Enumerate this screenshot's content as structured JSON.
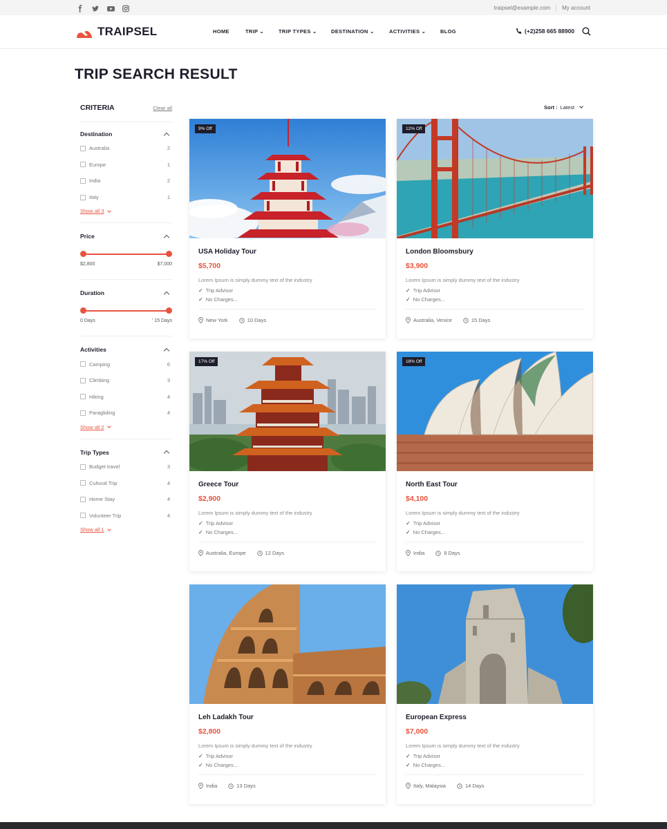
{
  "topbar": {
    "social_icons": [
      "facebook-icon",
      "twitter-icon",
      "youtube-icon",
      "instagram-icon"
    ],
    "email": "traipsel@example.com",
    "account": "My account"
  },
  "header": {
    "logo_text": "TRAIPSEL",
    "nav": [
      {
        "label": "HOME"
      },
      {
        "label": "TRIP ⌄"
      },
      {
        "label": "TRIP TYPES ⌄"
      },
      {
        "label": "DESTINATION ⌄"
      },
      {
        "label": "ACTIVITIES ⌄"
      },
      {
        "label": "BLOG"
      }
    ],
    "phone": "(+2)258 665 88900"
  },
  "page_title": "TRIP SEARCH RESULT",
  "sidebar": {
    "title": "CRITERIA",
    "clear_label": "Clear all",
    "destination": {
      "title": "Destination",
      "items": [
        {
          "label": "Australia",
          "count": "2"
        },
        {
          "label": "Europe",
          "count": "1"
        },
        {
          "label": "India",
          "count": "2"
        },
        {
          "label": "Italy",
          "count": "1"
        }
      ],
      "show_all": "Show all 3"
    },
    "price": {
      "title": "Price",
      "min": "$2,800",
      "max": "$7,000"
    },
    "duration": {
      "title": "Duration",
      "min": "0 Days",
      "max": "' 15 Days"
    },
    "activities": {
      "title": "Activities",
      "items": [
        {
          "label": "Camping",
          "count": "6"
        },
        {
          "label": "Climbing",
          "count": "3"
        },
        {
          "label": "Hiking",
          "count": "4"
        },
        {
          "label": "Paragliding",
          "count": "4"
        }
      ],
      "show_all": "Show all 2"
    },
    "trip_types": {
      "title": "Trip Types",
      "items": [
        {
          "label": "Budget travel",
          "count": "3"
        },
        {
          "label": "Cultural Trip",
          "count": "4"
        },
        {
          "label": "Home Stay",
          "count": "4"
        },
        {
          "label": "Volunteer Trip",
          "count": "4"
        }
      ],
      "show_all": "Show all 1"
    }
  },
  "sort": {
    "label": "Sort :",
    "value": "Latest"
  },
  "cards": [
    {
      "badge": "9% Off",
      "title": "USA Holiday Tour",
      "price": "$5,700",
      "desc": "Lorem Ipsum is simply dummy text of the industry",
      "feat1": "Trip Advisor",
      "feat2": "No Charges...",
      "location": "New York",
      "days": "10 Days"
    },
    {
      "badge": "12% Off",
      "title": "London Bloomsbury",
      "price": "$3,900",
      "desc": "Lorem Ipsum is simply dummy text of the industry",
      "feat1": "Trip Advisor",
      "feat2": "No Charges...",
      "location": "Australia, Venice",
      "days": "15 Days"
    },
    {
      "badge": "17% Off",
      "title": "Greece Tour",
      "price": "$2,900",
      "desc": "Lorem Ipsum is simply dummy text of the industry",
      "feat1": "Trip Advisor",
      "feat2": "No Charges...",
      "location": "Australia, Europe",
      "days": "12 Days"
    },
    {
      "badge": "18% Off",
      "title": "North East Tour",
      "price": "$4,100",
      "desc": "Lorem Ipsum is simply dummy text of the industry",
      "feat1": "Trip Advisor",
      "feat2": "No Charges...",
      "location": "India",
      "days": "8 Days"
    },
    {
      "badge": "",
      "title": "Leh Ladakh Tour",
      "price": "$2,800",
      "desc": "Lorem Ipsum is simply dummy text of the industry",
      "feat1": "Trip Advisor",
      "feat2": "No Charges...",
      "location": "India",
      "days": "13 Days"
    },
    {
      "badge": "",
      "title": "European Express",
      "price": "$7,000",
      "desc": "Lorem Ipsum is simply dummy text of the industry",
      "feat1": "Trip Advisor",
      "feat2": "No Charges...",
      "location": "Italy, Malaysia",
      "days": "14 Days"
    }
  ],
  "colors": {
    "accent": "#e8533d",
    "dark": "#1d1d2b"
  }
}
